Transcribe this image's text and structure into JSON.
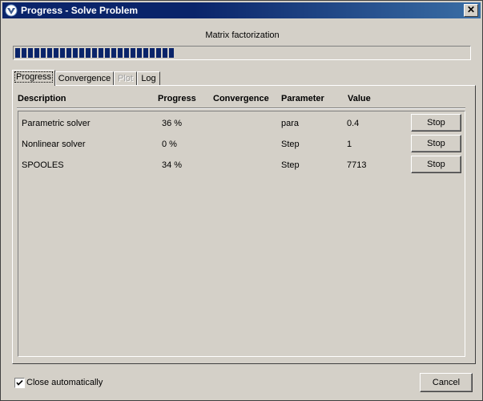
{
  "window": {
    "title": "Progress - Solve Problem",
    "close_glyph": "✕"
  },
  "status": {
    "text": "Matrix factorization",
    "progress_percent": 36
  },
  "tabs": [
    {
      "label": "Progress",
      "active": true,
      "disabled": false
    },
    {
      "label": "Convergence",
      "active": false,
      "disabled": false
    },
    {
      "label": "Plot",
      "active": false,
      "disabled": true
    },
    {
      "label": "Log",
      "active": false,
      "disabled": false
    }
  ],
  "table": {
    "headers": [
      "Description",
      "Progress",
      "Convergence",
      "Parameter",
      "Value"
    ],
    "rows": [
      {
        "description": "Parametric solver",
        "progress": "36 %",
        "convergence": "",
        "parameter": "para",
        "value": "0.4",
        "action": "Stop"
      },
      {
        "description": "Nonlinear solver",
        "progress": "0 %",
        "convergence": "",
        "parameter": "Step",
        "value": "1",
        "action": "Stop"
      },
      {
        "description": "SPOOLES",
        "progress": "34 %",
        "convergence": "",
        "parameter": "Step",
        "value": "7713",
        "action": "Stop"
      }
    ]
  },
  "footer": {
    "close_auto_label": "Close automatically",
    "close_auto_checked": true,
    "cancel_label": "Cancel"
  },
  "colors": {
    "titlebar": "#0a246a",
    "progress_fill": "#0a246a",
    "face": "#d4d0c8"
  }
}
